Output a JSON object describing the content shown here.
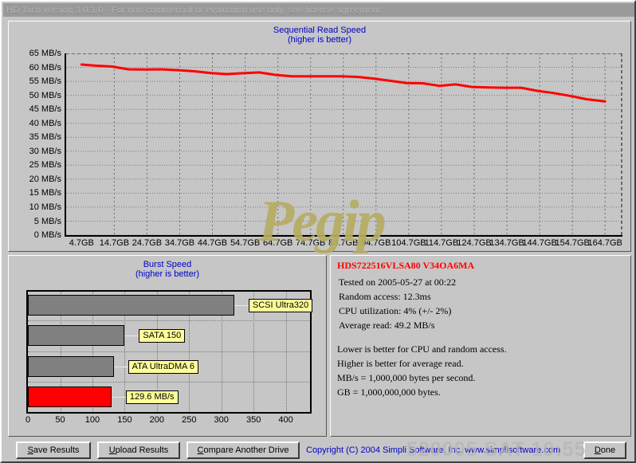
{
  "window": {
    "title": "HD Tach version 3.0.1.0 - For non-commercial or evaluation use only, see license agreement"
  },
  "sequential": {
    "title_line1": "Sequential Read Speed",
    "title_line2": "(higher is better)",
    "y_labels": [
      "65 MB/s",
      "60 MB/s",
      "55 MB/s",
      "50 MB/s",
      "45 MB/s",
      "40 MB/s",
      "35 MB/s",
      "30 MB/s",
      "25 MB/s",
      "20 MB/s",
      "15 MB/s",
      "10 MB/s",
      "5 MB/s",
      "0 MB/s"
    ],
    "x_labels": [
      "4.7GB",
      "14.7GB",
      "24.7GB",
      "34.7GB",
      "44.7GB",
      "54.7GB",
      "64.7GB",
      "74.7GB",
      "84.7GB",
      "94.7GB",
      "104.7GB",
      "114.7GB",
      "124.7GB",
      "134.7GB",
      "144.7GB",
      "154.7GB",
      "164.7GB"
    ]
  },
  "burst": {
    "title_line1": "Burst Speed",
    "title_line2": "(higher is better)",
    "x_labels": [
      "0",
      "50",
      "100",
      "150",
      "200",
      "250",
      "300",
      "350",
      "400"
    ],
    "bars": [
      {
        "label": "SCSI Ultra320",
        "value": 320,
        "color": "grey"
      },
      {
        "label": "SATA 150",
        "value": 150,
        "color": "grey"
      },
      {
        "label": "ATA UltraDMA 6",
        "value": 133,
        "color": "grey"
      },
      {
        "label": "129.6 MB/s",
        "value": 129.6,
        "color": "red"
      }
    ]
  },
  "info": {
    "drive": "HDS722516VLSA80 V34OA6MA",
    "tested": "Tested on 2005-05-27 at 00:22",
    "random_access": "Random access: 12.3ms",
    "cpu": "CPU utilization: 4% (+/- 2%)",
    "average_read": "Average read: 49.2 MB/s",
    "note1": "Lower is better for CPU and random access.",
    "note2": "Higher is better for average read.",
    "note3": "MB/s = 1,000,000 bytes per second.",
    "note4": "GB = 1,000,000,000 bytes."
  },
  "buttons": {
    "save": {
      "accel": "S",
      "rest": "ave Results"
    },
    "upload": {
      "accel": "U",
      "rest": "pload Results"
    },
    "compare": {
      "accel": "C",
      "rest": "ompare Another Drive"
    },
    "done": {
      "accel": "D",
      "rest": "one"
    }
  },
  "footer": {
    "copyright": "Copyright (C) 2004 Simpli Software, Inc.  www.simplisoftware.com"
  },
  "watermarks": {
    "script": "Pegip",
    "stamp": "520005 SAT 10:55"
  },
  "chart_data": {
    "type": "line",
    "title": "Sequential Read Speed",
    "subtitle": "(higher is better)",
    "xlabel": "",
    "ylabel": "MB/s",
    "xlim": [
      0,
      170
    ],
    "ylim": [
      0,
      65
    ],
    "grid": true,
    "legend": "none",
    "line_color": "#ff0000",
    "x": [
      4.7,
      9,
      14,
      19,
      24,
      29,
      34,
      39,
      44,
      49,
      54,
      59,
      64,
      69,
      74,
      79,
      84,
      89,
      94,
      99,
      104,
      109,
      114,
      119,
      124,
      129,
      134,
      139,
      144,
      149,
      154,
      159,
      164.7
    ],
    "y": [
      61.0,
      60.6,
      60.3,
      59.3,
      59.2,
      59.3,
      59.0,
      58.6,
      58.0,
      57.6,
      57.9,
      58.2,
      57.3,
      56.8,
      56.8,
      56.8,
      56.8,
      56.6,
      56.0,
      55.2,
      54.4,
      54.3,
      53.4,
      53.9,
      53.0,
      52.8,
      52.7,
      52.7,
      51.6,
      50.8,
      49.8,
      48.6,
      47.8
    ],
    "x_ticks": [
      4.7,
      14.7,
      24.7,
      34.7,
      44.7,
      54.7,
      64.7,
      74.7,
      84.7,
      94.7,
      104.7,
      114.7,
      124.7,
      134.7,
      144.7,
      154.7,
      164.7
    ],
    "y_ticks": [
      0,
      5,
      10,
      15,
      20,
      25,
      30,
      35,
      40,
      45,
      50,
      55,
      60,
      65
    ]
  },
  "chart_data_burst": {
    "type": "bar",
    "orientation": "horizontal",
    "title": "Burst Speed",
    "subtitle": "(higher is better)",
    "categories": [
      "SCSI Ultra320",
      "SATA 150",
      "ATA UltraDMA 6",
      "129.6 MB/s"
    ],
    "values": [
      320,
      150,
      133,
      129.6
    ],
    "xlim": [
      0,
      440
    ],
    "xlabel": "MB/s",
    "ylabel": ""
  }
}
